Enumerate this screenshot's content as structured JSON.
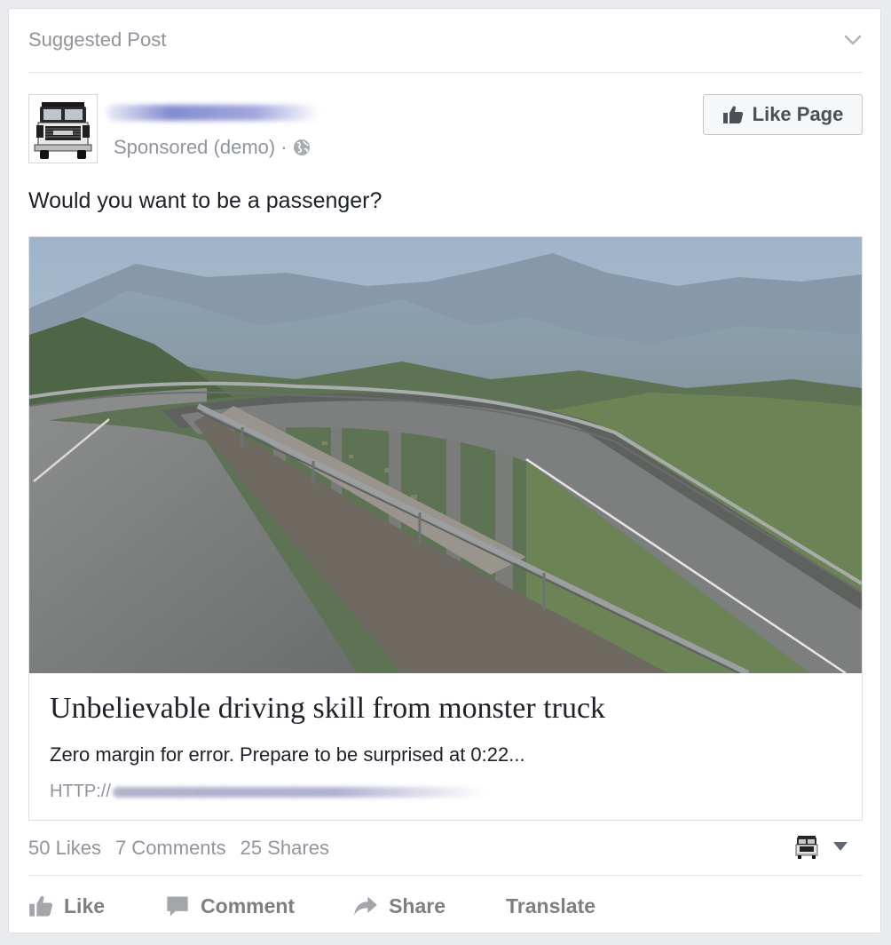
{
  "header": {
    "label": "Suggested Post"
  },
  "page": {
    "sponsored_label": "Sponsored (demo)",
    "separator": "·",
    "like_button_label": "Like Page"
  },
  "post": {
    "text": "Would you want to be a passenger?",
    "link": {
      "title": "Unbelievable driving skill from monster truck",
      "description": "Zero margin for error. Prepare to be surprised at 0:22...",
      "url_prefix": "HTTP://"
    }
  },
  "stats": {
    "likes": "50 Likes",
    "comments": "7 Comments",
    "shares": "25 Shares"
  },
  "actions": {
    "like": "Like",
    "comment": "Comment",
    "share": "Share",
    "translate": "Translate"
  },
  "icons": {
    "header": "chevron-down-icon",
    "audience": "globe-icon",
    "like_page": "thumbs-up-icon",
    "like": "thumbs-up-icon",
    "comment": "speech-bubble-icon",
    "share": "share-arrow-icon",
    "actor": "truck-avatar-icon",
    "menu": "caret-down-icon"
  },
  "colors": {
    "text_primary": "#1d2129",
    "text_secondary": "#90949c",
    "action_text": "#7f7f7f",
    "card_border": "#dddfe2",
    "background": "#e9ebee"
  }
}
